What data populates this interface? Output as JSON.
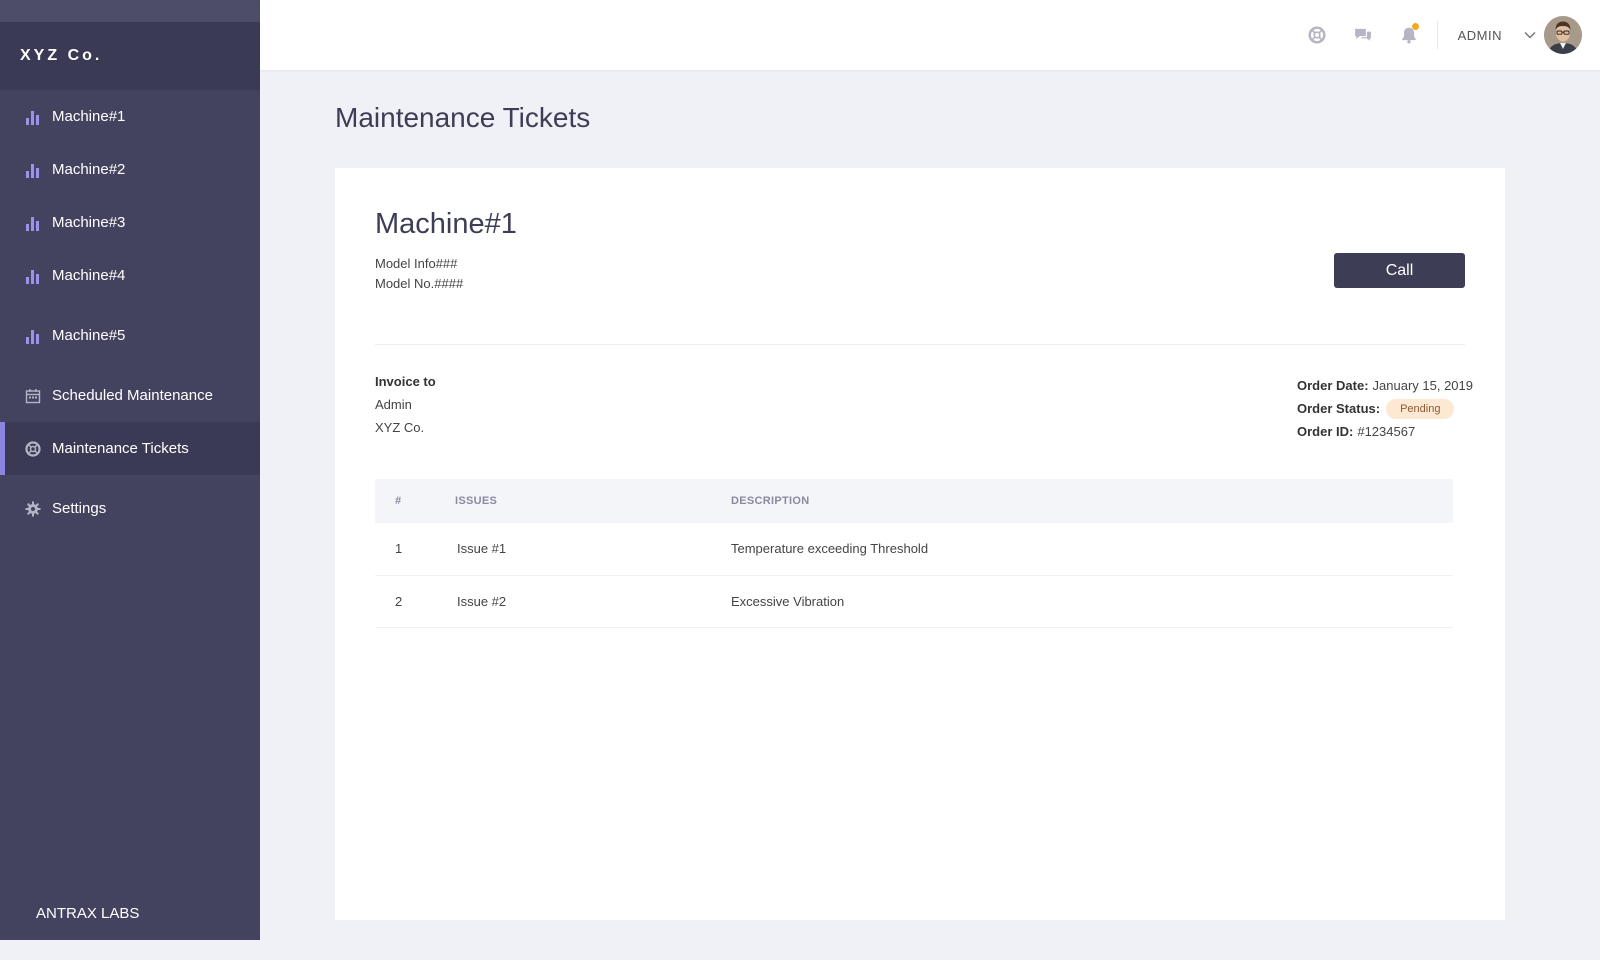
{
  "sidebar": {
    "brand": "XYZ Co.",
    "items": [
      {
        "label": "Machine#1",
        "icon": "bar-chart-icon"
      },
      {
        "label": "Machine#2",
        "icon": "bar-chart-icon"
      },
      {
        "label": "Machine#3",
        "icon": "bar-chart-icon"
      },
      {
        "label": "Machine#4",
        "icon": "bar-chart-icon"
      },
      {
        "label": "Machine#5",
        "icon": "bar-chart-icon"
      },
      {
        "label": "Scheduled Maintenance",
        "icon": "calendar-icon"
      },
      {
        "label": "Maintenance Tickets",
        "icon": "lifebuoy-icon",
        "active": true
      },
      {
        "label": "Settings",
        "icon": "gear-icon"
      }
    ],
    "footer": "ANTRAX LABS"
  },
  "topbar": {
    "icons": [
      "lifebuoy-icon",
      "chat-icon",
      "bell-icon"
    ],
    "user": "ADMIN"
  },
  "page": {
    "title": "Maintenance Tickets"
  },
  "ticket": {
    "machine": "Machine#1",
    "model_info": "Model Info###",
    "model_no": "Model No.####",
    "call_label": "Call",
    "invoice_to_label": "Invoice to",
    "invoice_name": "Admin",
    "invoice_company": "XYZ Co.",
    "order_date_label": "Order Date:",
    "order_date": "January 15, 2019",
    "order_status_label": "Order Status:",
    "order_status": "Pending",
    "order_id_label": "Order ID:",
    "order_id": "#1234567"
  },
  "table": {
    "headers": [
      "#",
      "ISSUES",
      "DESCRIPTION"
    ],
    "rows": [
      [
        "1",
        "Issue #1",
        "Temperature exceeding Threshold"
      ],
      [
        "2",
        "Issue #2",
        "Excessive Vibration"
      ]
    ]
  },
  "colors": {
    "sidebar_bg": "#434360",
    "accent": "#8b84e0",
    "notification_dot": "#f5a623",
    "pending_badge": "#fde8d3"
  }
}
